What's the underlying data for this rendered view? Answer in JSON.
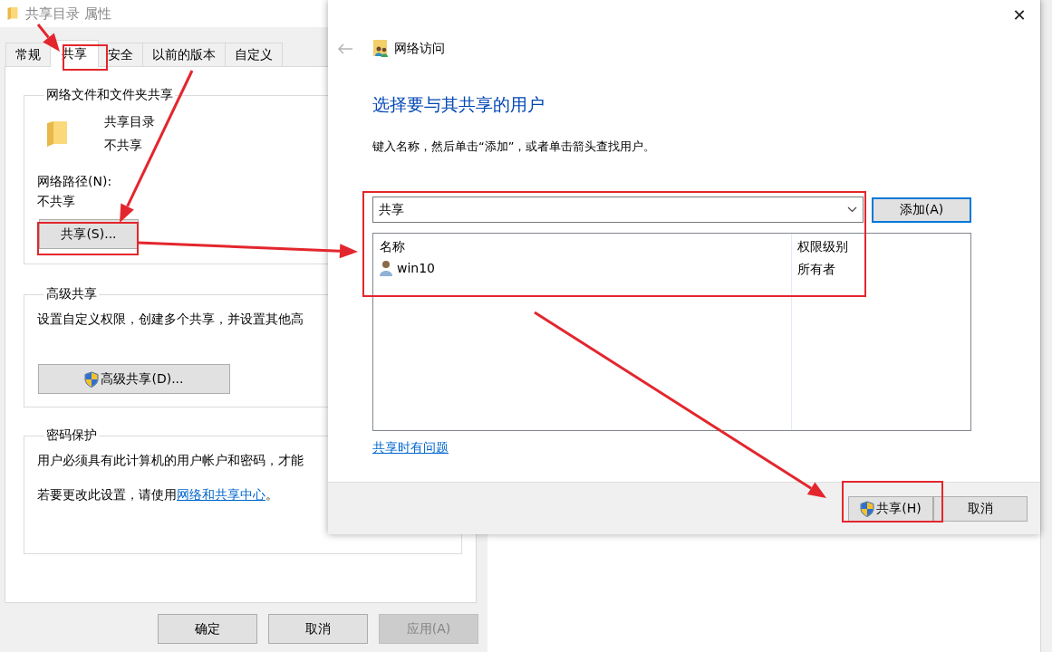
{
  "properties_window": {
    "title": "共享目录 属性",
    "tabs": [
      {
        "label": "常规",
        "selected": false
      },
      {
        "label": "共享",
        "selected": true
      },
      {
        "label": "安全",
        "selected": false
      },
      {
        "label": "以前的版本",
        "selected": false
      },
      {
        "label": "自定义",
        "selected": false
      }
    ],
    "network_sharing": {
      "heading": "网络文件和文件夹共享",
      "folder_name": "共享目录",
      "folder_status": "不共享",
      "path_label": "网络路径(N):",
      "path_value": "不共享",
      "button": {
        "label": "共享(S)...",
        "shield": false
      }
    },
    "advanced_sharing": {
      "heading": "高级共享",
      "description": "设置自定义权限，创建多个共享，并设置其他高",
      "button": {
        "label": "高级共享(D)...",
        "shield": true
      }
    },
    "password_protection": {
      "heading": "密码保护",
      "description": "用户必须具有此计算机的用户帐户和密码，才能",
      "note_before": "若要更改此设置，请使用",
      "note_link": "网络和共享中心",
      "note_after": "。"
    },
    "buttons": [
      {
        "label": "确定",
        "disabled": false
      },
      {
        "label": "取消",
        "disabled": false
      },
      {
        "label": "应用(A)",
        "disabled": true
      }
    ]
  },
  "network_access_window": {
    "title": "网络访问",
    "close": "✕",
    "heading": "选择要与其共享的用户",
    "instruction": "键入名称，然后单击“添加”，或者单击箭头查找用户。",
    "name_field": {
      "value": "共享"
    },
    "add_button": {
      "label": "添加(A)",
      "focused": true
    },
    "table": {
      "columns": [
        "名称",
        "权限级别"
      ],
      "rows": [
        {
          "name": "win10",
          "permission": "所有者"
        }
      ]
    },
    "help_link": "共享时有问题",
    "buttons": [
      {
        "label": "共享(H)",
        "shield": true
      },
      {
        "label": "取消",
        "shield": false
      }
    ]
  }
}
